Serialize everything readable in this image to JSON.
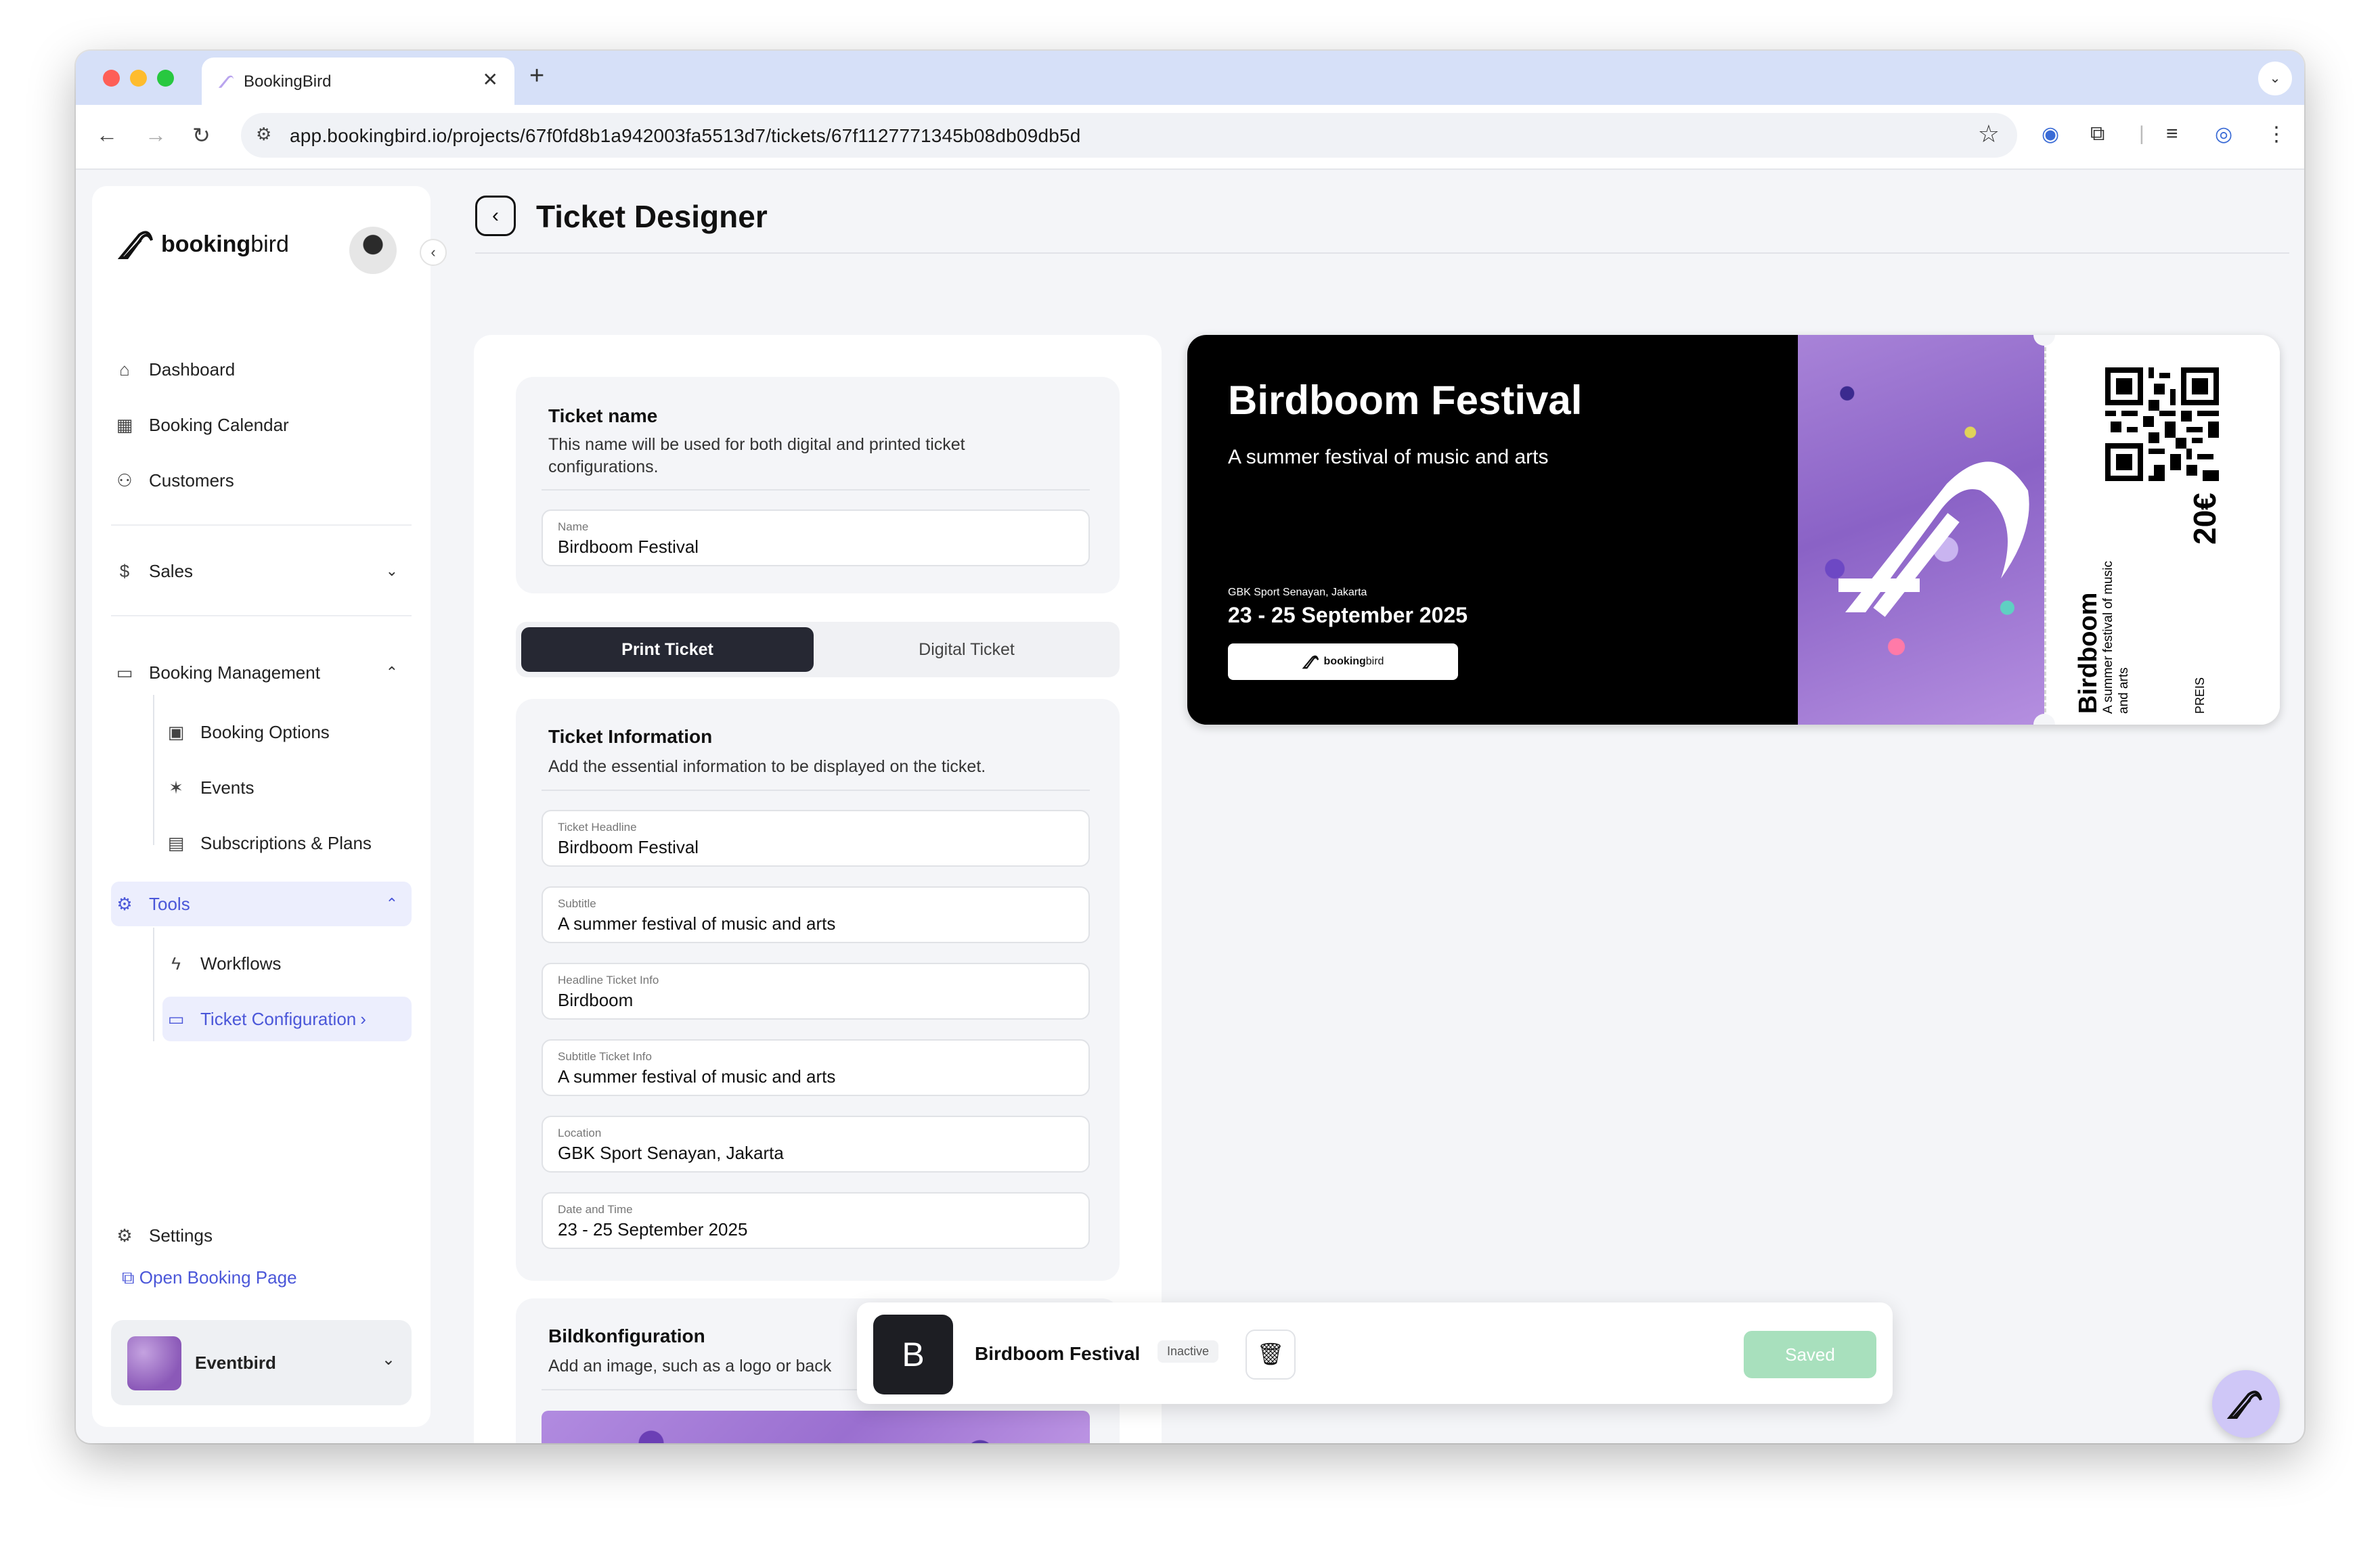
{
  "browser": {
    "tab_title": "BookingBird",
    "tab_close": "✕",
    "new_tab": "+",
    "url": "app.bookingbird.io/projects/67f0fd8b1a942003fa5513d7/tickets/67f1127771345b08db09db5d"
  },
  "sidebar": {
    "brand_bold": "booking",
    "brand_light": "bird",
    "items": {
      "dashboard": "Dashboard",
      "calendar": "Booking Calendar",
      "customers": "Customers",
      "sales": "Sales",
      "booking_management": "Booking Management",
      "booking_options": "Booking Options",
      "events": "Events",
      "subscriptions": "Subscriptions & Plans",
      "tools": "Tools",
      "workflows": "Workflows",
      "ticket_configuration": "Ticket Configuration",
      "settings": "Settings"
    },
    "open_booking_page": "Open Booking Page",
    "workspace": "Eventbird"
  },
  "header": {
    "title": "Ticket Designer"
  },
  "form": {
    "name_card": {
      "title": "Ticket name",
      "description": "This name will be used for both digital and printed ticket configurations.",
      "field_label": "Name",
      "field_value": "Birdboom Festival"
    },
    "tabs": {
      "print": "Print Ticket",
      "digital": "Digital Ticket"
    },
    "info_card": {
      "title": "Ticket Information",
      "description": "Add the essential information to be displayed on the ticket.",
      "fields": [
        {
          "label": "Ticket Headline",
          "value": "Birdboom Festival"
        },
        {
          "label": "Subtitle",
          "value": "A summer festival of music and arts"
        },
        {
          "label": "Headline Ticket Info",
          "value": "Birdboom"
        },
        {
          "label": "Subtitle Ticket Info",
          "value": "A summer festival of music and arts"
        },
        {
          "label": "Location",
          "value": "GBK Sport Senayan, Jakarta"
        },
        {
          "label": "Date and Time",
          "value": "23 - 25 September 2025"
        }
      ]
    },
    "image_card": {
      "title": "Bildkonfiguration",
      "description": "Add an image, such as a logo or back"
    }
  },
  "ticket": {
    "headline": "Birdboom Festival",
    "subtitle": "A summer festival of music and arts",
    "location": "GBK Sport Senayan, Jakarta",
    "date": "23 - 25 September 2025",
    "logo_bold": "booking",
    "logo_light": "bird",
    "stub_headline": "Birdboom",
    "stub_subtitle": "A summer festival of music and arts",
    "price": "20€",
    "price_label": "PREIS"
  },
  "savebar": {
    "initial": "B",
    "name": "Birdboom Festival",
    "status": "Inactive",
    "save": "Saved"
  },
  "colors": {
    "accent": "#4b57d9",
    "dark": "#262833",
    "saved_button": "#a8e0bd",
    "ticket_bg": "#000000"
  }
}
